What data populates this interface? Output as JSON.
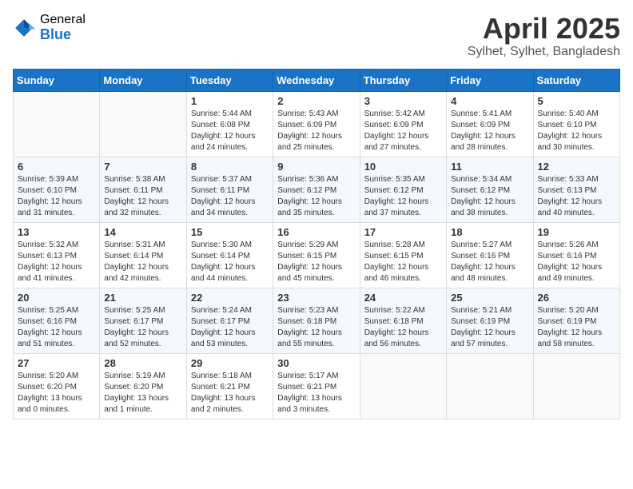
{
  "logo": {
    "general": "General",
    "blue": "Blue"
  },
  "header": {
    "month": "April 2025",
    "location": "Sylhet, Sylhet, Bangladesh"
  },
  "weekdays": [
    "Sunday",
    "Monday",
    "Tuesday",
    "Wednesday",
    "Thursday",
    "Friday",
    "Saturday"
  ],
  "weeks": [
    [
      {
        "day": "",
        "info": ""
      },
      {
        "day": "",
        "info": ""
      },
      {
        "day": "1",
        "info": "Sunrise: 5:44 AM\nSunset: 6:08 PM\nDaylight: 12 hours\nand 24 minutes."
      },
      {
        "day": "2",
        "info": "Sunrise: 5:43 AM\nSunset: 6:09 PM\nDaylight: 12 hours\nand 25 minutes."
      },
      {
        "day": "3",
        "info": "Sunrise: 5:42 AM\nSunset: 6:09 PM\nDaylight: 12 hours\nand 27 minutes."
      },
      {
        "day": "4",
        "info": "Sunrise: 5:41 AM\nSunset: 6:09 PM\nDaylight: 12 hours\nand 28 minutes."
      },
      {
        "day": "5",
        "info": "Sunrise: 5:40 AM\nSunset: 6:10 PM\nDaylight: 12 hours\nand 30 minutes."
      }
    ],
    [
      {
        "day": "6",
        "info": "Sunrise: 5:39 AM\nSunset: 6:10 PM\nDaylight: 12 hours\nand 31 minutes."
      },
      {
        "day": "7",
        "info": "Sunrise: 5:38 AM\nSunset: 6:11 PM\nDaylight: 12 hours\nand 32 minutes."
      },
      {
        "day": "8",
        "info": "Sunrise: 5:37 AM\nSunset: 6:11 PM\nDaylight: 12 hours\nand 34 minutes."
      },
      {
        "day": "9",
        "info": "Sunrise: 5:36 AM\nSunset: 6:12 PM\nDaylight: 12 hours\nand 35 minutes."
      },
      {
        "day": "10",
        "info": "Sunrise: 5:35 AM\nSunset: 6:12 PM\nDaylight: 12 hours\nand 37 minutes."
      },
      {
        "day": "11",
        "info": "Sunrise: 5:34 AM\nSunset: 6:12 PM\nDaylight: 12 hours\nand 38 minutes."
      },
      {
        "day": "12",
        "info": "Sunrise: 5:33 AM\nSunset: 6:13 PM\nDaylight: 12 hours\nand 40 minutes."
      }
    ],
    [
      {
        "day": "13",
        "info": "Sunrise: 5:32 AM\nSunset: 6:13 PM\nDaylight: 12 hours\nand 41 minutes."
      },
      {
        "day": "14",
        "info": "Sunrise: 5:31 AM\nSunset: 6:14 PM\nDaylight: 12 hours\nand 42 minutes."
      },
      {
        "day": "15",
        "info": "Sunrise: 5:30 AM\nSunset: 6:14 PM\nDaylight: 12 hours\nand 44 minutes."
      },
      {
        "day": "16",
        "info": "Sunrise: 5:29 AM\nSunset: 6:15 PM\nDaylight: 12 hours\nand 45 minutes."
      },
      {
        "day": "17",
        "info": "Sunrise: 5:28 AM\nSunset: 6:15 PM\nDaylight: 12 hours\nand 46 minutes."
      },
      {
        "day": "18",
        "info": "Sunrise: 5:27 AM\nSunset: 6:16 PM\nDaylight: 12 hours\nand 48 minutes."
      },
      {
        "day": "19",
        "info": "Sunrise: 5:26 AM\nSunset: 6:16 PM\nDaylight: 12 hours\nand 49 minutes."
      }
    ],
    [
      {
        "day": "20",
        "info": "Sunrise: 5:25 AM\nSunset: 6:16 PM\nDaylight: 12 hours\nand 51 minutes."
      },
      {
        "day": "21",
        "info": "Sunrise: 5:25 AM\nSunset: 6:17 PM\nDaylight: 12 hours\nand 52 minutes."
      },
      {
        "day": "22",
        "info": "Sunrise: 5:24 AM\nSunset: 6:17 PM\nDaylight: 12 hours\nand 53 minutes."
      },
      {
        "day": "23",
        "info": "Sunrise: 5:23 AM\nSunset: 6:18 PM\nDaylight: 12 hours\nand 55 minutes."
      },
      {
        "day": "24",
        "info": "Sunrise: 5:22 AM\nSunset: 6:18 PM\nDaylight: 12 hours\nand 56 minutes."
      },
      {
        "day": "25",
        "info": "Sunrise: 5:21 AM\nSunset: 6:19 PM\nDaylight: 12 hours\nand 57 minutes."
      },
      {
        "day": "26",
        "info": "Sunrise: 5:20 AM\nSunset: 6:19 PM\nDaylight: 12 hours\nand 58 minutes."
      }
    ],
    [
      {
        "day": "27",
        "info": "Sunrise: 5:20 AM\nSunset: 6:20 PM\nDaylight: 13 hours\nand 0 minutes."
      },
      {
        "day": "28",
        "info": "Sunrise: 5:19 AM\nSunset: 6:20 PM\nDaylight: 13 hours\nand 1 minute."
      },
      {
        "day": "29",
        "info": "Sunrise: 5:18 AM\nSunset: 6:21 PM\nDaylight: 13 hours\nand 2 minutes."
      },
      {
        "day": "30",
        "info": "Sunrise: 5:17 AM\nSunset: 6:21 PM\nDaylight: 13 hours\nand 3 minutes."
      },
      {
        "day": "",
        "info": ""
      },
      {
        "day": "",
        "info": ""
      },
      {
        "day": "",
        "info": ""
      }
    ]
  ]
}
